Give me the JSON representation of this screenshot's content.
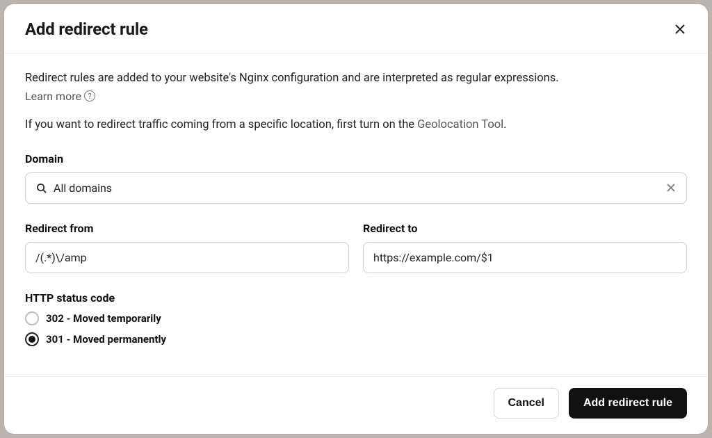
{
  "header": {
    "title": "Add redirect rule"
  },
  "intro": {
    "text": "Redirect rules are added to your website's Nginx configuration and are interpreted as regular expressions.",
    "learn_more": "Learn more"
  },
  "note": {
    "prefix": "If you want to redirect traffic coming from a specific location, first turn on the ",
    "link": "Geolocation Tool",
    "suffix": "."
  },
  "domain": {
    "label": "Domain",
    "value": "All domains"
  },
  "redirect_from": {
    "label": "Redirect from",
    "value": "/(.*)\\/amp"
  },
  "redirect_to": {
    "label": "Redirect to",
    "value": "https://example.com/$1"
  },
  "status": {
    "label": "HTTP status code",
    "options": [
      {
        "id": "302",
        "label": "302 - Moved temporarily",
        "selected": false
      },
      {
        "id": "301",
        "label": "301 - Moved permanently",
        "selected": true
      }
    ]
  },
  "footer": {
    "cancel": "Cancel",
    "submit": "Add redirect rule"
  }
}
